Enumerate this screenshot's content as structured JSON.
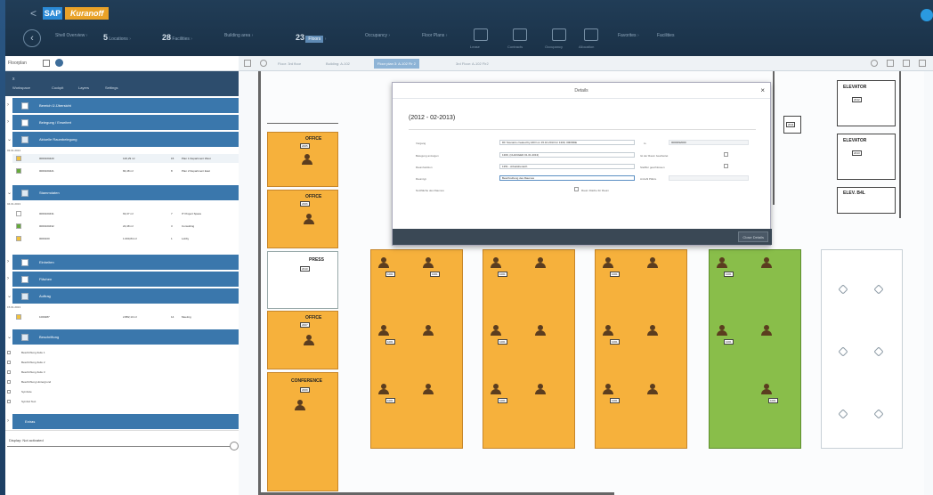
{
  "app": {
    "back": "<",
    "sap": "SAP",
    "brand": "Kuranoff"
  },
  "steps": [
    {
      "count": "",
      "label": "Shell Overview"
    },
    {
      "count": "5",
      "label": "Locations"
    },
    {
      "count": "28",
      "label": "Facilities"
    },
    {
      "count": "",
      "label": "Building area"
    },
    {
      "count": "23",
      "label": "Floors",
      "active": true
    },
    {
      "count": "",
      "label": "Occupancy"
    },
    {
      "count": "",
      "label": "Floor Plans"
    }
  ],
  "step_icons": [
    "Lease",
    "Contracts",
    "Occupancy",
    "Allocation"
  ],
  "step_tail": [
    "Favorites",
    "Facilities"
  ],
  "left": {
    "toolbar_title": "Floorplan",
    "header_x": "x",
    "header_tabs": [
      "Workspace",
      "Cockpit",
      "Layers",
      "Settings"
    ],
    "groups": [
      {
        "label": "Bereich Ü-Übersicht",
        "checked": false
      },
      {
        "label": "Belegung / Erweitert",
        "checked": false
      },
      {
        "label": "Aktuelle Raumbelegung",
        "checked": true
      },
      {
        "label": "Stammdaten",
        "checked": true
      },
      {
        "label": "Einheiten",
        "checked": false
      },
      {
        "label": "Flächen",
        "checked": false
      },
      {
        "label": "Auftrag",
        "checked": true
      },
      {
        "label": "Beschriftung",
        "checked": true
      },
      {
        "label": "Extras",
        "checked": false
      }
    ],
    "date1": "03.01.2013",
    "rows1": [
      {
        "color": "#f2c23c",
        "name": "0000100420",
        "area": "126,29 m²",
        "n": "15",
        "desc": "Plan 1 Department West"
      },
      {
        "color": "#66a93c",
        "name": "0000100421",
        "area": "84,48 m²",
        "n": "8",
        "desc": "Plan 2 Department East"
      }
    ],
    "date2": "04.01.2013",
    "rows2": [
      {
        "color": "#ffffff",
        "name": "0000100431",
        "area": "63,37 m²",
        "n": "7",
        "desc": "IT Project Space"
      },
      {
        "color": "#66a93c",
        "name": "0000100432",
        "area": "22,48 m²",
        "n": "3",
        "desc": "Consulting"
      },
      {
        "color": "#f2c23c",
        "name": "0000100",
        "area": "1.000,84 m²",
        "n": "1",
        "desc": "Lobby"
      }
    ],
    "date3": "15.01.2013",
    "rows3": [
      {
        "color": "#f2c23c",
        "name": "1000287",
        "area": "2.882,13 m²",
        "n": "14",
        "desc": "Meeting"
      }
    ],
    "sub_items": [
      "Beschriftung Zeile 1",
      "Beschriftung Zeile 2",
      "Beschriftung Zeile 3",
      "Beschriftung Hintergrund",
      "Symbole",
      "Symbol Text"
    ],
    "bottom_label": "Display: Not activated"
  },
  "right": {
    "tabs": [
      "Floor: 3rd floor",
      "Building: A-102",
      "Floor plan 3: A-102 Flr 2",
      "3rd Floor: A-102 Flr2"
    ],
    "selected_tab": 2
  },
  "plan": {
    "rooms": [
      "OFFICE",
      "OFFICE",
      "OFFICE",
      "OFFICE",
      "CONFERENCE",
      "PRESS",
      "ELEVATOR",
      "ELEVATOR",
      "ELEV. B4L"
    ],
    "codes": [
      "2005",
      "2006",
      "2007",
      "2008",
      "2009",
      "2010",
      "2011",
      "2012",
      "2013"
    ],
    "desk_label": "1001"
  },
  "dialog": {
    "title": "Details",
    "close": "×",
    "range": "(2012 - 02-2013)",
    "fields": [
      {
        "label": "Vorgang",
        "value": "DF Scenario created by ADO on 15.10.2013 for 1309, 00RRDE",
        "extra_label": "to",
        "extra_value": "0000092000"
      },
      {
        "label": "Belegung anzeigen",
        "value": "1309, (CHANGED 01.01.2013)",
        "check_label": "Ist der Raum bearbeitet"
      },
      {
        "label": "Raumfunktion",
        "value": "1351 - Arbeitsbereich",
        "check_label": "Stellflur geschlossen"
      },
      {
        "label": "Raumtyp",
        "value": "Beschreibung des Raumes",
        "check_label": "Anzahl Plätze"
      },
      {
        "label": "Nutzfläche des Raumes",
        "value": "Raum Fläche für Raum"
      }
    ],
    "footer_button": "Close Details"
  },
  "colors": {
    "occupied": "#f6b13c",
    "free": "#89be4a",
    "accent": "#3a77ac"
  }
}
